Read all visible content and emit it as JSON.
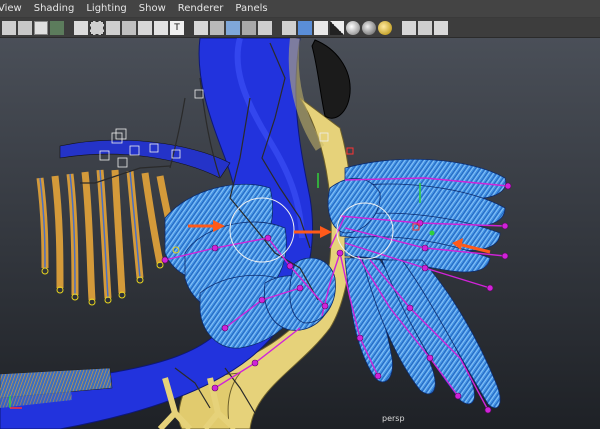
{
  "menu": [
    "View",
    "Shading",
    "Lighting",
    "Show",
    "Renderer",
    "Panels"
  ],
  "toolbar_icons": [
    "select-camera",
    "camera-attributes",
    "bookmark",
    "image-plane",
    "grid",
    "film-gate",
    "resolution-gate",
    "gate-mask",
    "field-chart",
    "safe-action",
    "safe-title",
    "wireframe",
    "smooth-shade",
    "textured",
    "shadows",
    "use-lights",
    "isolate-select",
    "xray",
    "xray-joints",
    "default-material",
    "wireframe-on-shaded",
    "backface",
    "high-quality",
    "ambient-occlusion",
    "motion-blur",
    "anti-alias",
    "depth-of-field",
    "two-side",
    "cube-view",
    "quad-view",
    "graph-editor"
  ],
  "viewport": {
    "camera_label": "persp",
    "background_top": "#4a4f58",
    "background_bottom": "#1e2126"
  },
  "colors": {
    "body_blue": "#2233dd",
    "beak_yellow": "#e6d27a",
    "feather_blue": "#3f93e6",
    "joint_magenta": "#d023d8",
    "arrow_orange": "#ff5a1a",
    "gold_feathers": "#d49a3a"
  }
}
